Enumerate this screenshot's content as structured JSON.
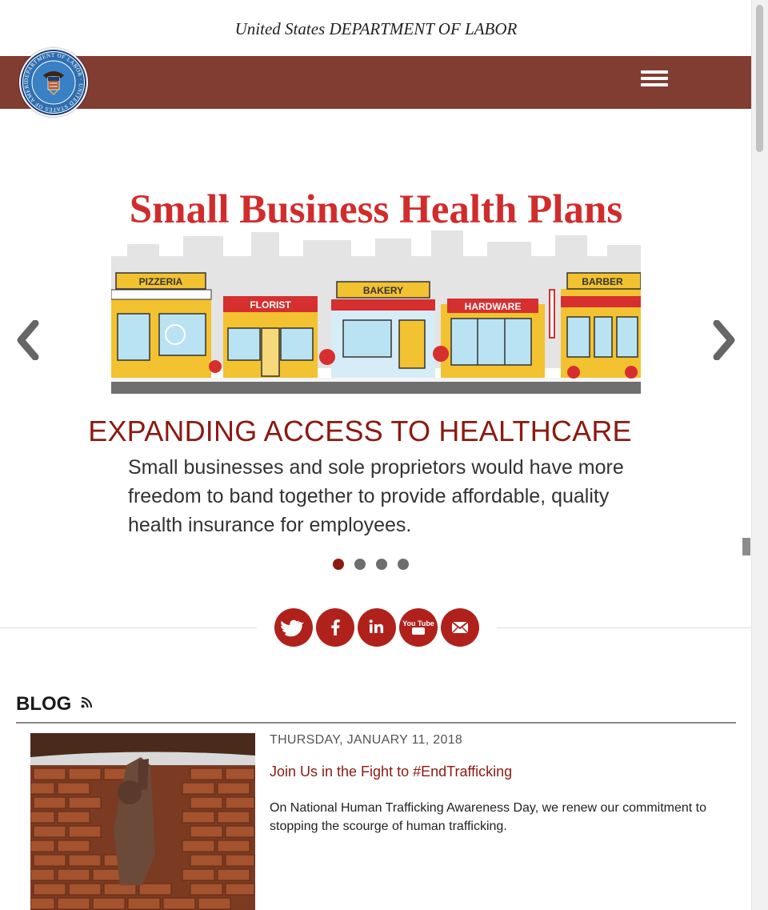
{
  "header": {
    "agency_title": "United States DEPARTMENT OF LABOR",
    "seal_text": "DEPARTMENT OF LABOR · UNITED STATES OF AMERICA",
    "nav_color": "#823d33"
  },
  "carousel": {
    "image": {
      "title": "Small Business Health Plans",
      "storefronts": [
        "PIZZERIA",
        "FLORIST",
        "BAKERY",
        "HARDWARE",
        "BARBER"
      ]
    },
    "heading": "EXPANDING ACCESS TO HEALTHCARE",
    "text": "Small businesses and sole proprietors would have more freedom to band together to provide affordable, quality health insurance for employees.",
    "slide_count": 4,
    "active_index": 0,
    "icons": {
      "prev": "chevron-left-icon",
      "next": "chevron-right-icon"
    }
  },
  "social": {
    "icons": [
      "twitter-icon",
      "facebook-icon",
      "linkedin-icon",
      "youtube-icon",
      "email-icon"
    ],
    "youtube_label": "You Tube"
  },
  "blog": {
    "title": "BLOG",
    "post": {
      "date": "THURSDAY, JANUARY 11, 2018",
      "link": "Join Us in the Fight to #EndTrafficking",
      "summary": "On National Human Trafficking Awareness Day, we renew our commitment to stopping the scourge of human trafficking."
    }
  },
  "colors": {
    "accent": "#8b1a12",
    "social_button": "#b0211c",
    "dot_inactive": "#6e6e6e"
  }
}
